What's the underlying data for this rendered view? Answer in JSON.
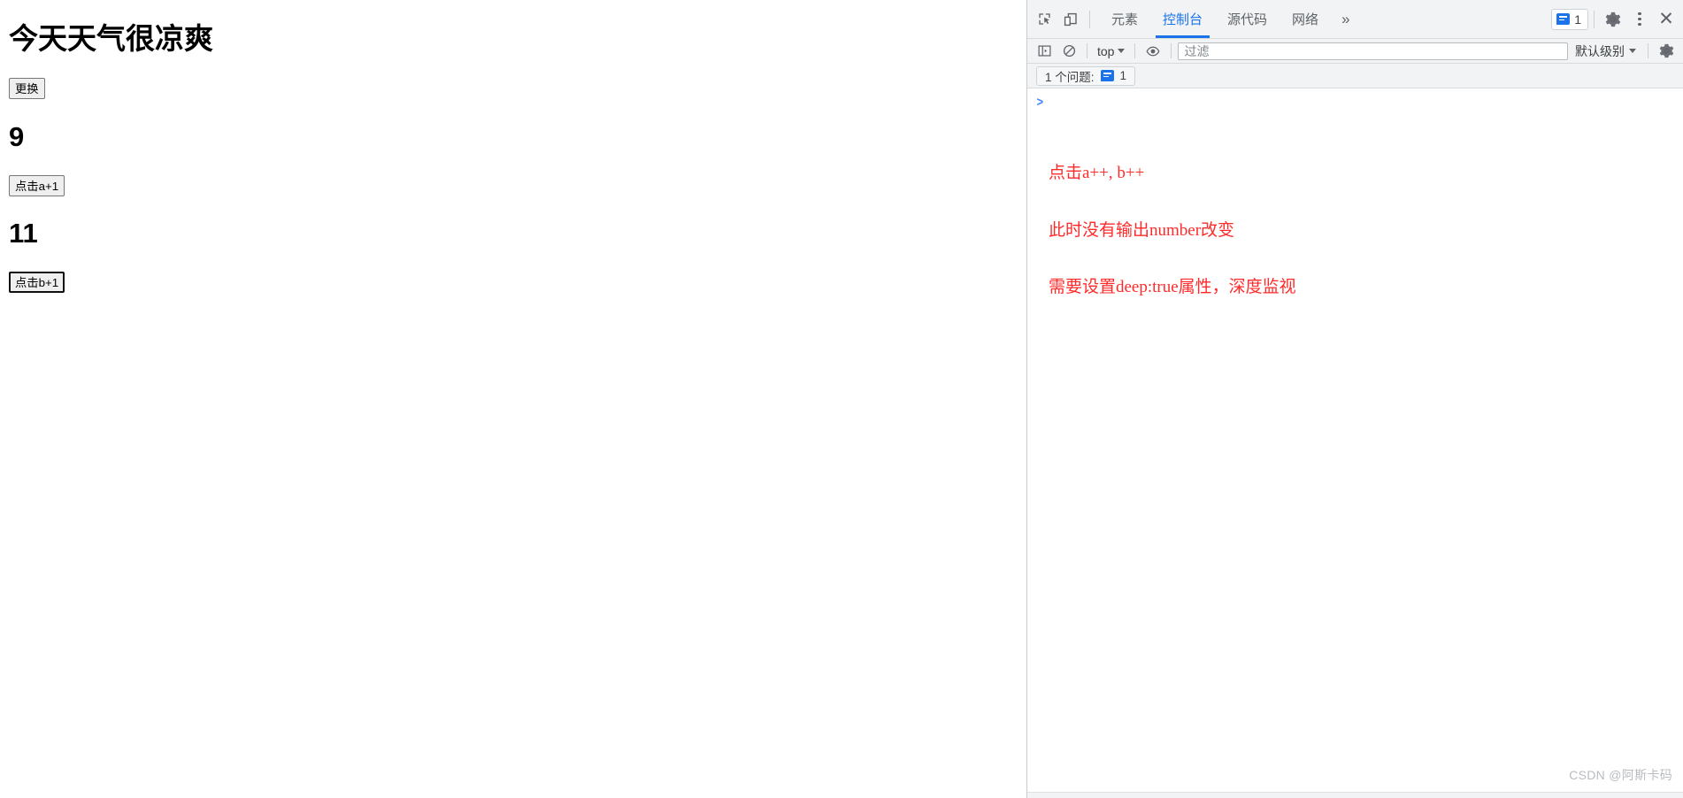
{
  "page": {
    "heading": "今天天气很凉爽",
    "change_button": "更换",
    "value_a": "9",
    "button_a": "点击a+1",
    "value_b": "11",
    "button_b": "点击b+1"
  },
  "devtools": {
    "toolbar": {
      "inspect_icon": "inspect-element-icon",
      "device_icon": "device-toolbar-icon",
      "tabs": [
        {
          "label": "元素",
          "active": false
        },
        {
          "label": "控制台",
          "active": true
        },
        {
          "label": "源代码",
          "active": false
        },
        {
          "label": "网络",
          "active": false
        }
      ],
      "more_tabs": "»",
      "issue_count": "1",
      "settings_icon": "gear-icon",
      "menu_icon": "kebab-menu-icon",
      "close_icon": "close-icon"
    },
    "filterbar": {
      "sidebar_toggle_icon": "console-sidebar-icon",
      "clear_icon": "clear-console-icon",
      "context": "top",
      "eye_icon": "live-expression-icon",
      "filter_placeholder": "过滤",
      "filter_value": "",
      "level": "默认级别",
      "settings_icon": "console-settings-gear-icon"
    },
    "issuebar": {
      "label": "1 个问题:",
      "count": "1"
    },
    "console": {
      "prompt": ">",
      "annotation_line_1": "点击a++, b++",
      "annotation_line_2": "此时没有输出number改变",
      "annotation_line_3": "需要设置deep:true属性，深度监视",
      "watermark": "CSDN @阿斯卡码"
    }
  },
  "colors": {
    "accent_blue": "#1a73e8",
    "annotation_red": "#ff2b2b",
    "toolbar_bg": "#f1f3f4",
    "text_primary": "#202124",
    "text_secondary": "#5f6368"
  }
}
